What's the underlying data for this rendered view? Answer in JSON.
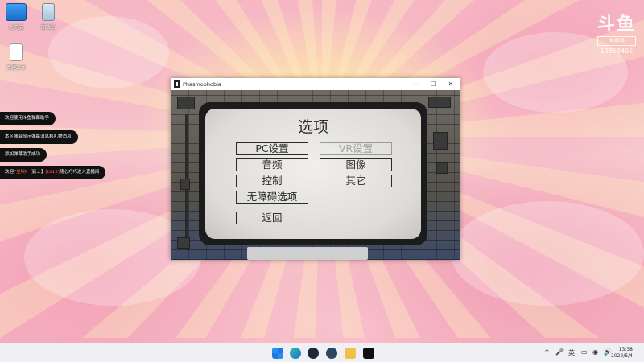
{
  "desktop": {
    "icons": [
      {
        "label": "此电脑",
        "icon": "computer-icon"
      },
      {
        "label": "回收站",
        "icon": "recycle-bin-icon"
      },
      {
        "label": "新建文本",
        "icon": "text-file-icon"
      }
    ]
  },
  "watermark": {
    "logo": "斗鱼",
    "tag": "房间号",
    "room": "10858405"
  },
  "chat": [
    {
      "text": "欢迎使用斗鱼弹幕助手"
    },
    {
      "text": "本区域会显示弹幕消息和礼物消息"
    },
    {
      "text": "添加弹幕助手成功"
    },
    {
      "prefix": "欢迎",
      "user": "F尘埃F",
      "badge": "【骑士】",
      "level": "[LV13]",
      "suffix": "随心巧巧进入直播间"
    }
  ],
  "window": {
    "title": "Phasmophobia",
    "controls": {
      "minimize": "—",
      "maximize": "☐",
      "close": "✕"
    }
  },
  "menu": {
    "heading": "选项",
    "buttons": {
      "pc": "PC设置",
      "vr": "VR设置",
      "audio": "音频",
      "graphics": "图像",
      "controls": "控制",
      "other": "其它",
      "accessibility": "无障碍选项",
      "back": "返回"
    }
  },
  "taskbar": {
    "apps": [
      "windows-start-icon",
      "search-icon",
      "edge-browser-icon",
      "steam-icon",
      "steam-alt-icon",
      "danmaku-assistant-icon",
      "phasmophobia-icon"
    ],
    "tray": {
      "chevron": "^",
      "language": "英",
      "clock_time": "13:38",
      "clock_date": "2022/5/4"
    }
  }
}
